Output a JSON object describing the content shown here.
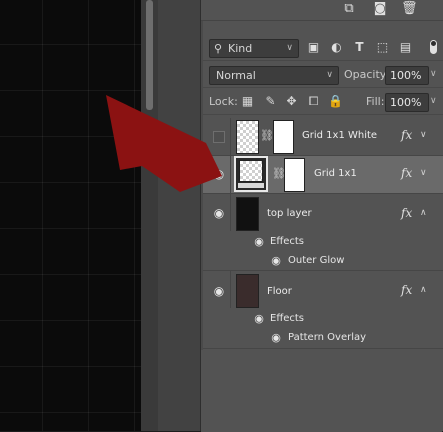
{
  "panel": {
    "top_tools": {
      "icons": [
        "new-layer-icon",
        "camera-icon",
        "trash-icon"
      ]
    },
    "filter": {
      "kind_label": "Kind",
      "filter_icons": [
        "image-filter-icon",
        "adjustment-filter-icon",
        "type-filter-icon",
        "shape-filter-icon",
        "smart-object-filter-icon"
      ]
    },
    "blend": {
      "mode": "Normal",
      "opacity_label": "Opacity:",
      "opacity_value": "100%"
    },
    "lock": {
      "label": "Lock:",
      "fill_label": "Fill:",
      "fill_value": "100%"
    },
    "layers": [
      {
        "name": "Grid 1x1 White",
        "visible": false,
        "selected": false,
        "fx": "fx"
      },
      {
        "name": "Grid 1x1",
        "visible": true,
        "selected": true,
        "fx": "fx"
      },
      {
        "name": "top layer",
        "visible": true,
        "selected": false,
        "fx": "fx",
        "effects_label": "Effects",
        "effects": [
          "Outer Glow"
        ],
        "thumb_color": "#111111"
      },
      {
        "name": "Floor",
        "visible": true,
        "selected": false,
        "fx": "fx",
        "effects_label": "Effects",
        "effects": [
          "Pattern Overlay"
        ],
        "thumb_color": "#3a2c2c"
      }
    ]
  },
  "annotation": {
    "arrow_color": "#8b1212"
  }
}
